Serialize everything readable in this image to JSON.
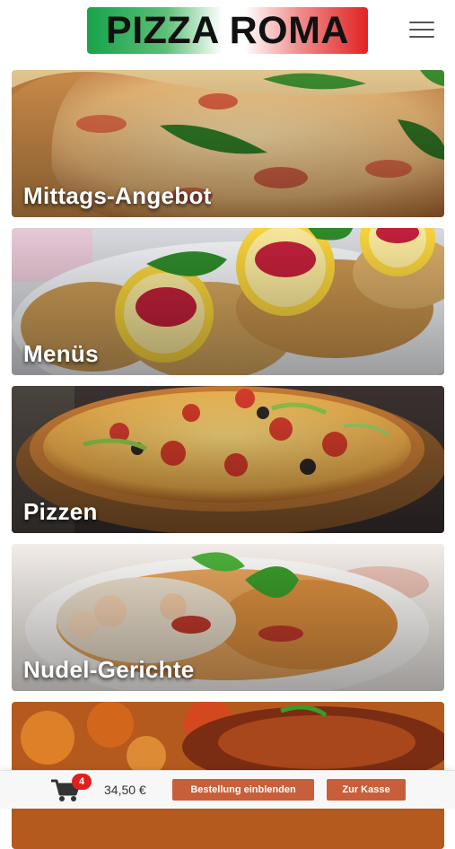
{
  "header": {
    "logo_text": "PIZZA ROMA",
    "menu_icon": "hamburger-menu-icon"
  },
  "categories": [
    {
      "label": "Mittags-Angebot"
    },
    {
      "label": "Menüs"
    },
    {
      "label": "Pizzen"
    },
    {
      "label": "Nudel-Gerichte"
    },
    {
      "label": ""
    }
  ],
  "cart": {
    "icon": "shopping-cart-icon",
    "count": "4",
    "total": "34,50 €",
    "show_order_label": "Bestellung einblenden",
    "checkout_label": "Zur Kasse"
  },
  "colors": {
    "button": "#c85f3a",
    "badge": "#e02020",
    "logo_green": "#17a34a",
    "logo_red": "#e02424"
  }
}
